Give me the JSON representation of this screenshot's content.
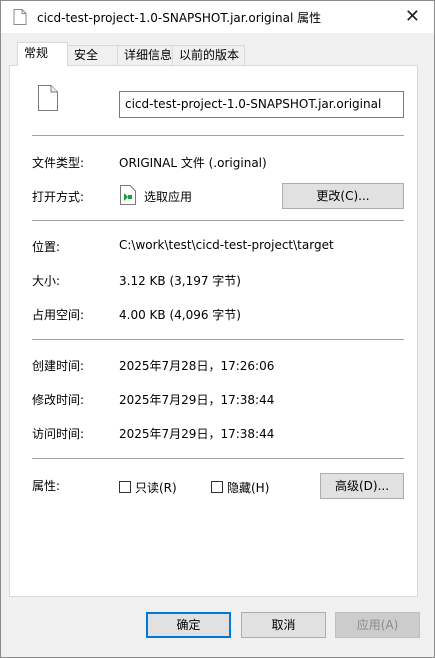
{
  "window": {
    "title": "cicd-test-project-1.0-SNAPSHOT.jar.original 属性",
    "close_glyph": "✕"
  },
  "tabs": [
    {
      "label": "常规",
      "active": true
    },
    {
      "label": "安全",
      "active": false
    },
    {
      "label": "详细信息",
      "active": false
    },
    {
      "label": "以前的版本",
      "active": false
    }
  ],
  "general": {
    "file_name": "cicd-test-project-1.0-SNAPSHOT.jar.original",
    "file_type_label": "文件类型:",
    "file_type_value": "ORIGINAL 文件 (.original)",
    "open_with_label": "打开方式:",
    "open_with_value": "选取应用",
    "change_button": "更改(C)...",
    "location_label": "位置:",
    "location_value": "C:\\work\\test\\cicd-test-project\\target",
    "size_label": "大小:",
    "size_value": "3.12 KB (3,197 字节)",
    "size_on_disk_label": "占用空间:",
    "size_on_disk_value": "4.00 KB (4,096 字节)",
    "created_label": "创建时间:",
    "created_value": "2025年7月28日，17:26:06",
    "modified_label": "修改时间:",
    "modified_value": "2025年7月29日，17:38:44",
    "accessed_label": "访问时间:",
    "accessed_value": "2025年7月29日，17:38:44",
    "attributes_label": "属性:",
    "readonly_label": "只读(R)",
    "hidden_label": "隐藏(H)",
    "advanced_button": "高级(D)..."
  },
  "footer": {
    "ok": "确定",
    "cancel": "取消",
    "apply": "应用(A)"
  },
  "colors": {
    "accent": "#0078d7",
    "dialog_bg": "#f0f0f0",
    "panel_bg": "#ffffff"
  }
}
